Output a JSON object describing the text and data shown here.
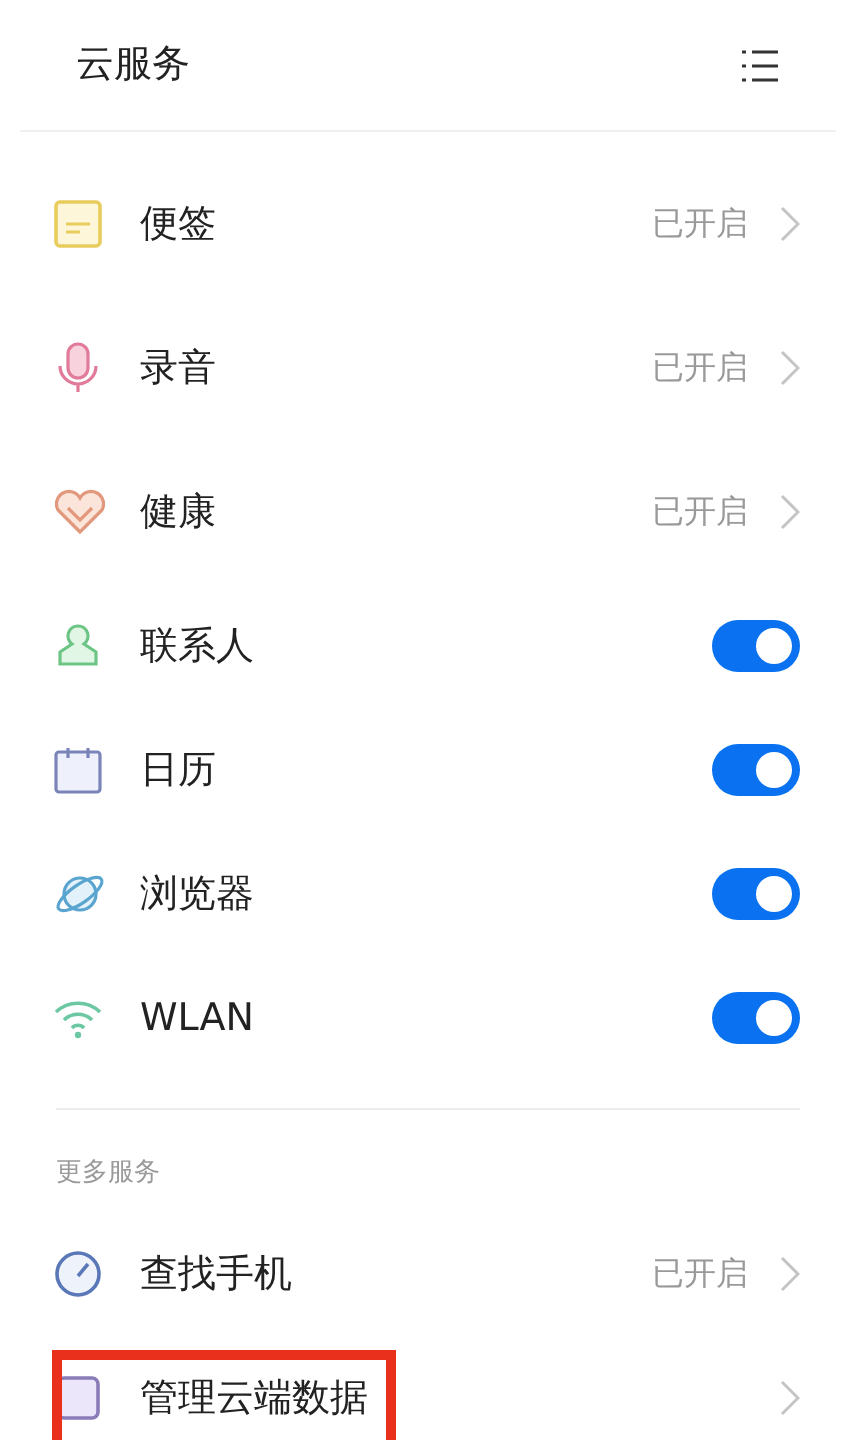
{
  "header": {
    "title": "云服务"
  },
  "services": [
    {
      "kind": "status",
      "label": "便签",
      "status": "已开启"
    },
    {
      "kind": "status",
      "label": "录音",
      "status": "已开启"
    },
    {
      "kind": "status",
      "label": "健康",
      "status": "已开启"
    },
    {
      "kind": "toggle",
      "label": "联系人",
      "on": true
    },
    {
      "kind": "toggle",
      "label": "日历",
      "on": true
    },
    {
      "kind": "toggle",
      "label": "浏览器",
      "on": true
    },
    {
      "kind": "toggle",
      "label": "WLAN",
      "on": true
    }
  ],
  "more_services": {
    "heading": "更多服务",
    "items": [
      {
        "kind": "status",
        "label": "查找手机",
        "status": "已开启",
        "highlighted": false
      },
      {
        "kind": "link",
        "label": "管理云端数据",
        "highlighted": true
      }
    ]
  }
}
